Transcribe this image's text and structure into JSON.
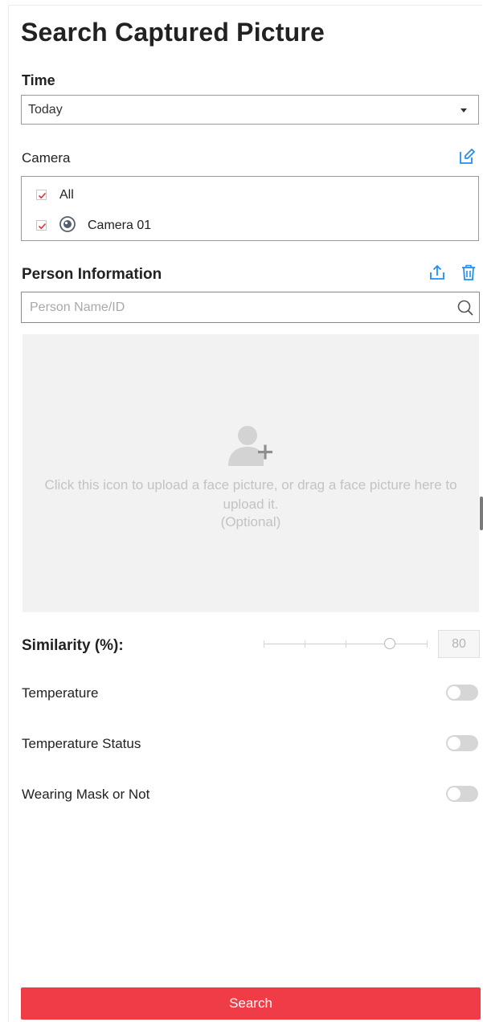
{
  "title": "Search Captured Picture",
  "time": {
    "label": "Time",
    "selected": "Today"
  },
  "camera": {
    "label": "Camera",
    "items": [
      {
        "label": "All",
        "checked": true
      },
      {
        "label": "Camera 01",
        "checked": true,
        "icon": "camera-icon"
      }
    ]
  },
  "person": {
    "label": "Person Information",
    "search_placeholder": "Person Name/ID",
    "search_value": "",
    "upload_hint": "Click this icon to upload a face picture, or drag a face picture here to upload it.",
    "upload_optional": "(Optional)"
  },
  "similarity": {
    "label": "Similarity (%):",
    "value": "80",
    "slider_fraction": 0.8
  },
  "toggles": [
    {
      "label": "Temperature",
      "on": false
    },
    {
      "label": "Temperature Status",
      "on": false
    },
    {
      "label": "Wearing Mask or Not",
      "on": false
    }
  ],
  "search_button": "Search",
  "colors": {
    "accent_blue": "#1f8ff0",
    "primary_red": "#f03c46",
    "check_red": "#e5323e"
  }
}
